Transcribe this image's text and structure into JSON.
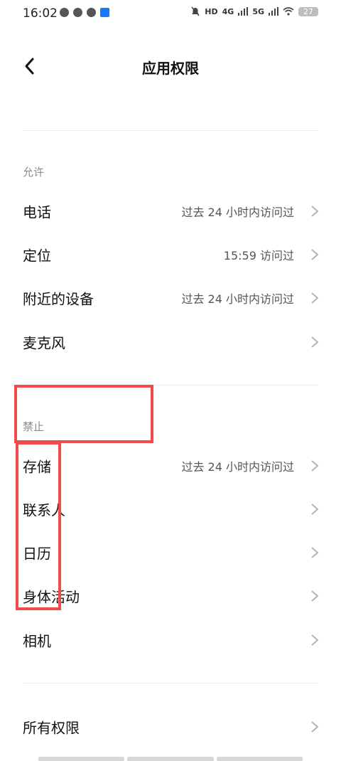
{
  "status_bar": {
    "time": "16:02",
    "network_1": "4G",
    "network_2": "5G",
    "hd": "HD",
    "battery": "27"
  },
  "header": {
    "title": "应用权限"
  },
  "allowed": {
    "label": "允许",
    "items": [
      {
        "label": "电话",
        "status": "过去 24 小时内访问过"
      },
      {
        "label": "定位",
        "status": "15:59 访问过"
      },
      {
        "label": "附近的设备",
        "status": "过去 24 小时内访问过"
      },
      {
        "label": "麦克风",
        "status": ""
      }
    ]
  },
  "denied": {
    "label": "禁止",
    "items": [
      {
        "label": "存储",
        "status": "过去 24 小时内访问过"
      },
      {
        "label": "联系人",
        "status": ""
      },
      {
        "label": "日历",
        "status": ""
      },
      {
        "label": "身体活动",
        "status": ""
      },
      {
        "label": "相机",
        "status": ""
      }
    ]
  },
  "all_permissions": {
    "label": "所有权限"
  },
  "colors": {
    "annotation": "#f24a4a",
    "secondary_text": "#8a8a8a",
    "divider": "#ececec"
  }
}
